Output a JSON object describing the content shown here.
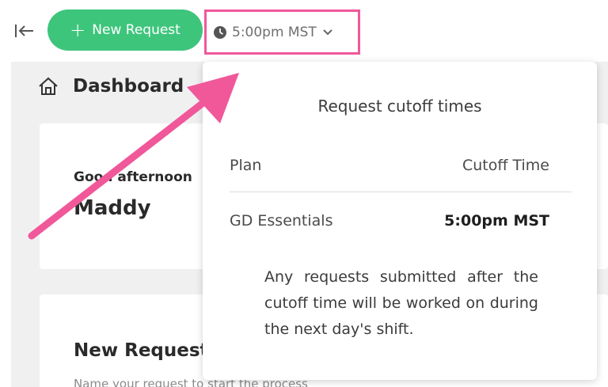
{
  "toolbar": {
    "new_request_label": "New Request",
    "time_select_value": "5:00pm MST"
  },
  "page": {
    "title": "Dashboard"
  },
  "greeting": {
    "text": "Good afternoon",
    "name": "Maddy"
  },
  "new_request_card": {
    "title": "New Request",
    "subtitle": "Name your request to start the process"
  },
  "popover": {
    "title": "Request cutoff times",
    "columns": [
      "Plan",
      "Cutoff Time"
    ],
    "rows": [
      {
        "plan": "GD Essentials",
        "cutoff": "5:00pm MST"
      }
    ],
    "note": "Any requests submitted after the cutoff time will be worked on during the next day's shift."
  },
  "colors": {
    "accent_green": "#3ec57c",
    "highlight_pink": "#f0589a"
  },
  "icons": {
    "collapse": "collapse-left-icon",
    "clock": "clock-icon",
    "home": "home-icon",
    "chevron": "chevron-down-icon"
  }
}
